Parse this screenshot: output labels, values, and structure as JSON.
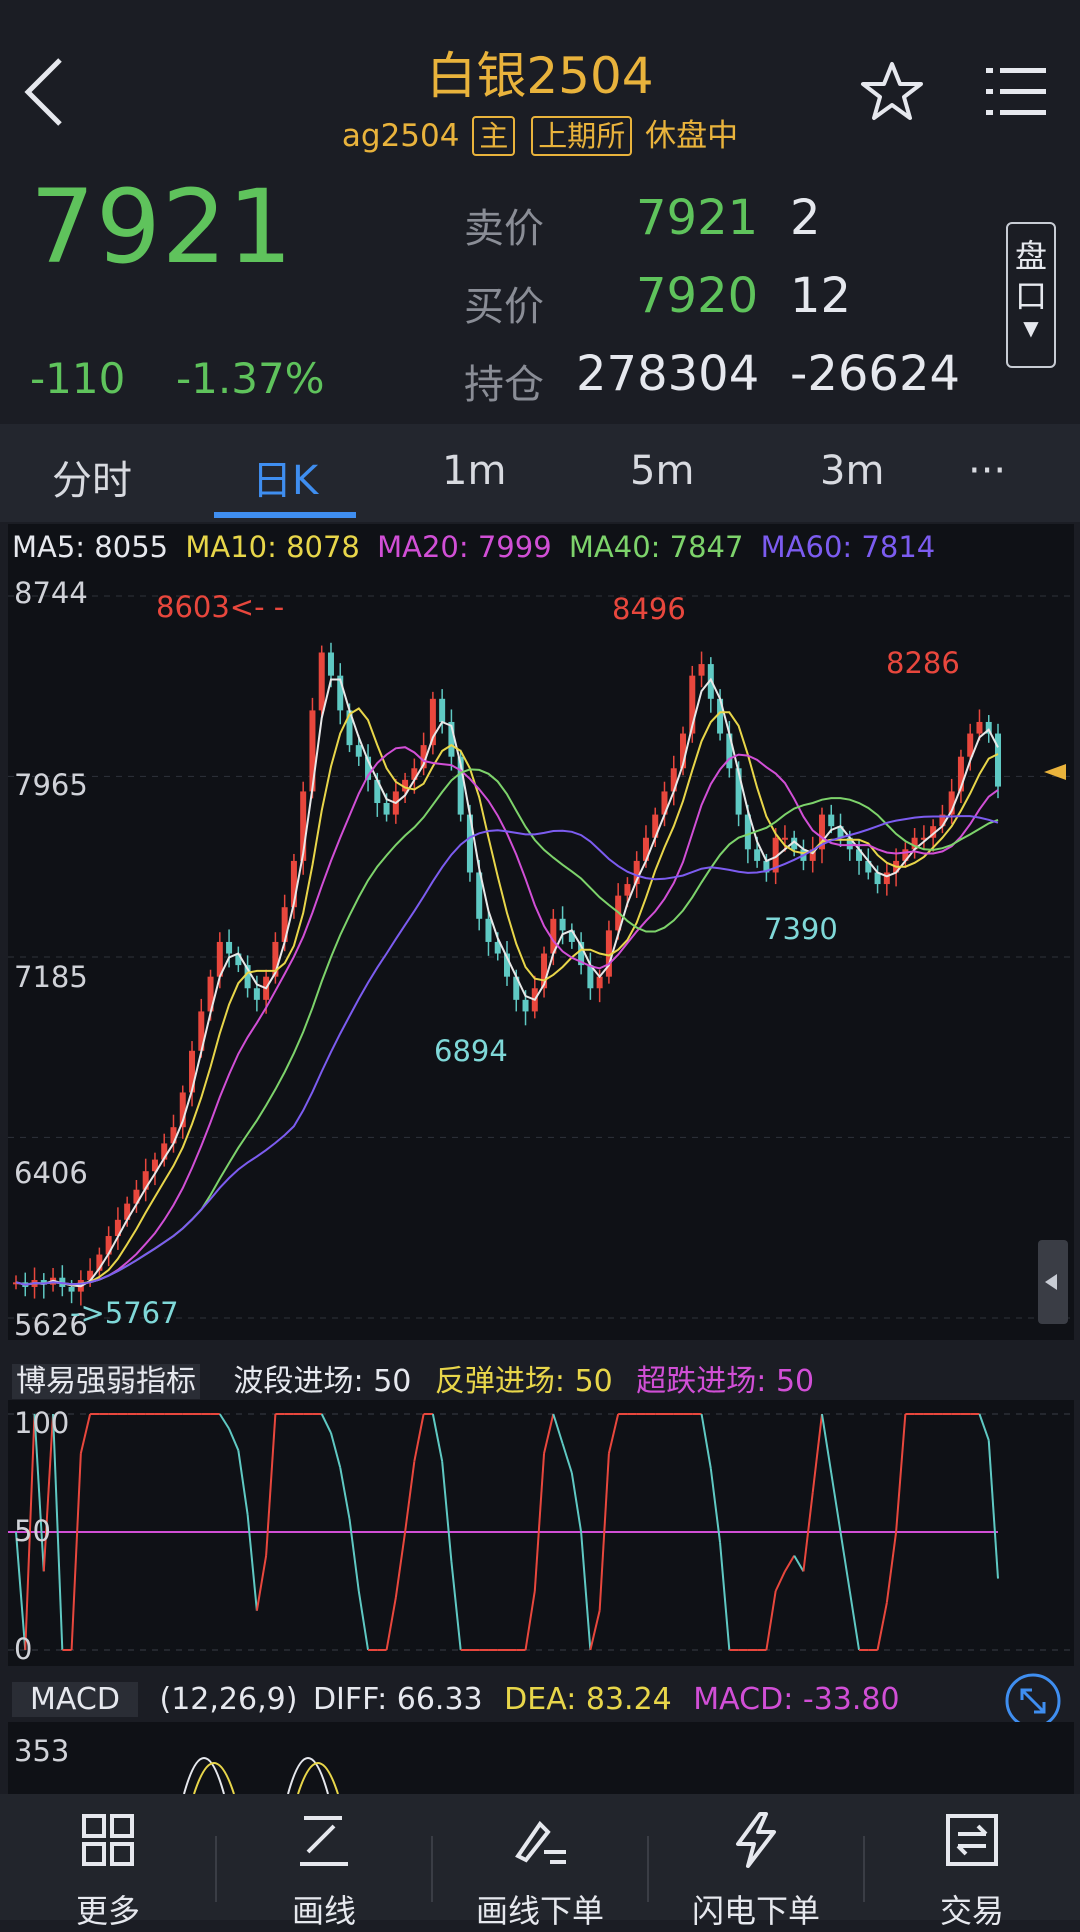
{
  "header": {
    "title": "白银2504",
    "code": "ag2504",
    "tag_main": "主",
    "tag_exchange": "上期所",
    "status": "休盘中"
  },
  "quote": {
    "last_price": "7921",
    "change": "-110",
    "change_pct": "-1.37%",
    "ask_label": "卖价",
    "ask_price": "7921",
    "ask_vol": "2",
    "bid_label": "买价",
    "bid_price": "7920",
    "bid_vol": "12",
    "oi_label": "持仓",
    "oi": "278304",
    "oi_change": "-26624",
    "depth_button": "盘口"
  },
  "tabs": [
    {
      "label": "分时",
      "active": false
    },
    {
      "label": "日K",
      "active": true
    },
    {
      "label": "1m",
      "active": false
    },
    {
      "label": "5m",
      "active": false
    },
    {
      "label": "3m",
      "active": false
    },
    {
      "label": "···",
      "active": false
    }
  ],
  "ma": {
    "ma5": "MA5: 8055",
    "ma10": "MA10: 8078",
    "ma20": "MA20: 7999",
    "ma40": "MA40: 7847",
    "ma60": "MA60: 7814"
  },
  "chart_data": {
    "type": "candlestick",
    "y_axis_ticks": [
      "8744",
      "7965",
      "7185",
      "6406",
      "5626"
    ],
    "ylim": [
      5626,
      8744
    ],
    "annotations": [
      {
        "text": "8603<- -",
        "value": 8603,
        "color": "#e8473d"
      },
      {
        "text": "8496",
        "value": 8496,
        "color": "#e8473d"
      },
      {
        "text": "8286",
        "value": 8286,
        "color": "#e8473d"
      },
      {
        "text": "7390",
        "value": 7390,
        "color": "#7fd8d8"
      },
      {
        "text": "6894",
        "value": 6894,
        "color": "#7fd8d8"
      },
      {
        "text": "->5767",
        "value": 5767,
        "color": "#7fd8d8"
      }
    ],
    "close_series": [
      5780,
      5760,
      5790,
      5770,
      5800,
      5760,
      5740,
      5790,
      5830,
      5900,
      5980,
      6050,
      6120,
      6180,
      6260,
      6310,
      6380,
      6450,
      6600,
      6780,
      6950,
      7100,
      7250,
      7200,
      7150,
      7050,
      7000,
      7100,
      7250,
      7400,
      7600,
      7900,
      8250,
      8500,
      8400,
      8250,
      8100,
      8050,
      7950,
      7850,
      7800,
      7900,
      7950,
      8000,
      8100,
      8300,
      8200,
      8050,
      7800,
      7550,
      7350,
      7250,
      7200,
      7100,
      7000,
      6950,
      7050,
      7200,
      7350,
      7300,
      7250,
      7150,
      7050,
      7100,
      7300,
      7450,
      7500,
      7600,
      7700,
      7800,
      7900,
      8000,
      8150,
      8400,
      8450,
      8300,
      8150,
      8000,
      7800,
      7650,
      7600,
      7550,
      7700,
      7700,
      7650,
      7600,
      7650,
      7800,
      7750,
      7700,
      7650,
      7600,
      7550,
      7500,
      7550,
      7600,
      7650,
      7700,
      7700,
      7750,
      7800,
      7900,
      8050,
      8150,
      8200,
      8150,
      7921
    ],
    "ma_series": [
      {
        "name": "MA5",
        "color": "#e8e8e8",
        "lag": 2
      },
      {
        "name": "MA10",
        "color": "#e8d64a",
        "lag": 5
      },
      {
        "name": "MA20",
        "color": "#d14fd6",
        "lag": 10
      },
      {
        "name": "MA40",
        "color": "#7dd36b",
        "lag": 20
      },
      {
        "name": "MA60",
        "color": "#7c5cf0",
        "lag": 30
      }
    ]
  },
  "indicator": {
    "title": "博易强弱指标",
    "wave": "波段进场: 50",
    "rebound": "反弹进场: 50",
    "oversold": "超跌进场: 50",
    "ticks": [
      "100",
      "50",
      "0"
    ]
  },
  "macd": {
    "label": "MACD",
    "params": "(12,26,9)",
    "diff": "DIFF: 66.33",
    "dea": "DEA: 83.24",
    "macd": "MACD: -33.80",
    "tick": "353"
  },
  "bottom": [
    {
      "label": "更多",
      "icon": "grid-icon"
    },
    {
      "label": "画线",
      "icon": "draw-line-icon"
    },
    {
      "label": "画线下单",
      "icon": "draw-order-icon"
    },
    {
      "label": "闪电下单",
      "icon": "lightning-icon"
    },
    {
      "label": "交易",
      "icon": "trade-icon"
    }
  ],
  "colors": {
    "up": "#e8473d",
    "down": "#5fc9c3",
    "gold": "#e9b33c",
    "green": "#5fc35c",
    "accent": "#3f8ef0"
  }
}
